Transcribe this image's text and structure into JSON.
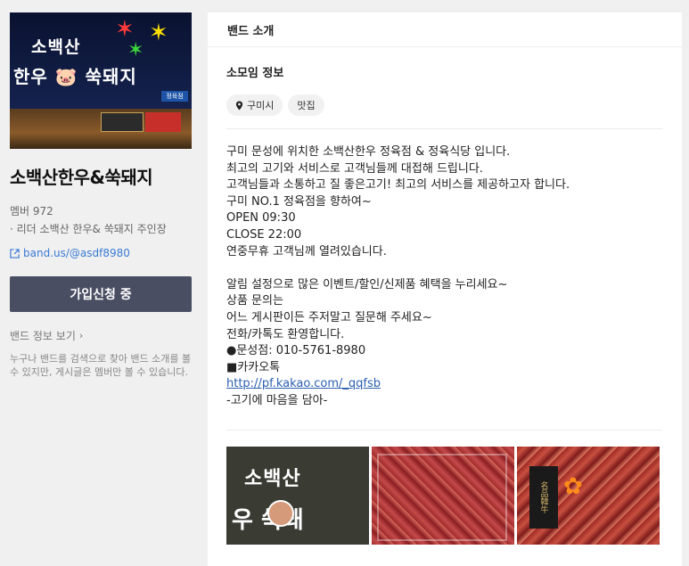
{
  "sidebar": {
    "cover": {
      "sign_line1": "소백산",
      "sign_line2": "한우 🐷 쑥돼지",
      "sub_sign": "정육점"
    },
    "band_name": "소백산한우&쑥돼지",
    "member_count": "멤버 972",
    "leader": "· 리더 소백산 한우& 쑥돼지 주인장",
    "band_url": "band.us/@asdf8980",
    "join_button": "가입신청 중",
    "info_link": "밴드 정보 보기",
    "search_note": "누구나 밴드를 검색으로 찾아 밴드 소개를 볼 수 있지만, 게시글은 멤버만 볼 수 있습니다."
  },
  "main": {
    "header": "밴드 소개",
    "section_title": "소모임 정보",
    "tags": [
      "구미시",
      "맛집"
    ],
    "description": [
      "구미 문성에 위치한 소백산한우 정육점 & 정육식당 입니다.",
      "최고의 고기와 서비스로 고객님들께 대접해 드립니다.",
      "고객님들과 소통하고 질 좋은고기! 최고의 서비스를 제공하고자 합니다.",
      "구미 NO.1 정육점을 향하여~",
      "OPEN 09:30",
      "CLOSE 22:00",
      "연중무휴 고객님께 열려있습니다.",
      "",
      "알림 설정으로 많은 이벤트/할인/신제품 혜택을 누리세요~",
      "상품 문의는",
      "어느 게시판이든 주저말고 질문해 주세요~",
      "전화/카톡도 환영합니다.",
      "●문성점: 010-5761-8980",
      "■카카오톡"
    ],
    "kakao_link": "http://pf.kakao.com/_qqfsb",
    "closing_line": "-고기에 마음을 담아-",
    "photos": {
      "photo1_text1": "소백산",
      "photo1_text2": "우   쑥돼"
    }
  },
  "colors": {
    "join_button_bg": "#4a4e63",
    "link": "#3a7bd5"
  }
}
